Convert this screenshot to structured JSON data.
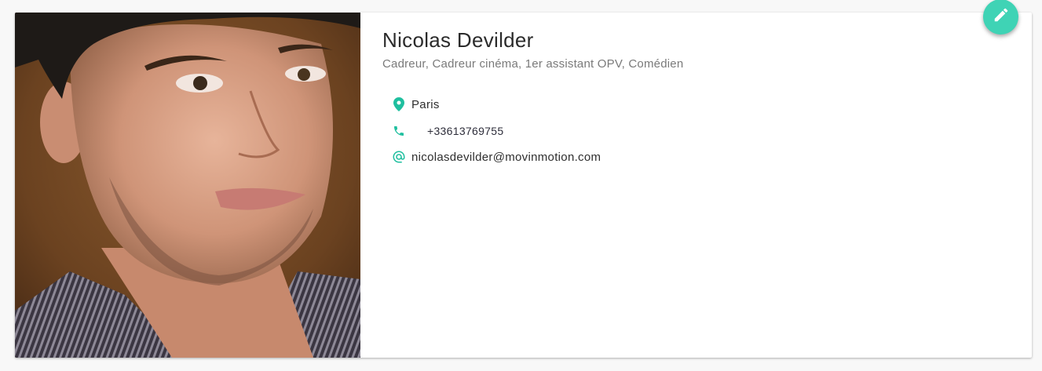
{
  "profile": {
    "name": "Nicolas Devilder",
    "roles": "Cadreur, Cadreur cinéma, 1er assistant OPV, Comédien",
    "photo_icon": "profile-photo",
    "contacts": {
      "location": "Paris",
      "phone": "+33613769755",
      "email": "nicolasdevilder@movinmotion.com"
    }
  },
  "edit_button": {
    "icon": "pencil-icon"
  },
  "colors": {
    "accent": "#1fbf9f",
    "fab": "#3fd3b5",
    "name_text": "#2b2b2b",
    "roles_text": "#7a7a7a",
    "background": "#f8f8f8",
    "card": "#ffffff"
  }
}
